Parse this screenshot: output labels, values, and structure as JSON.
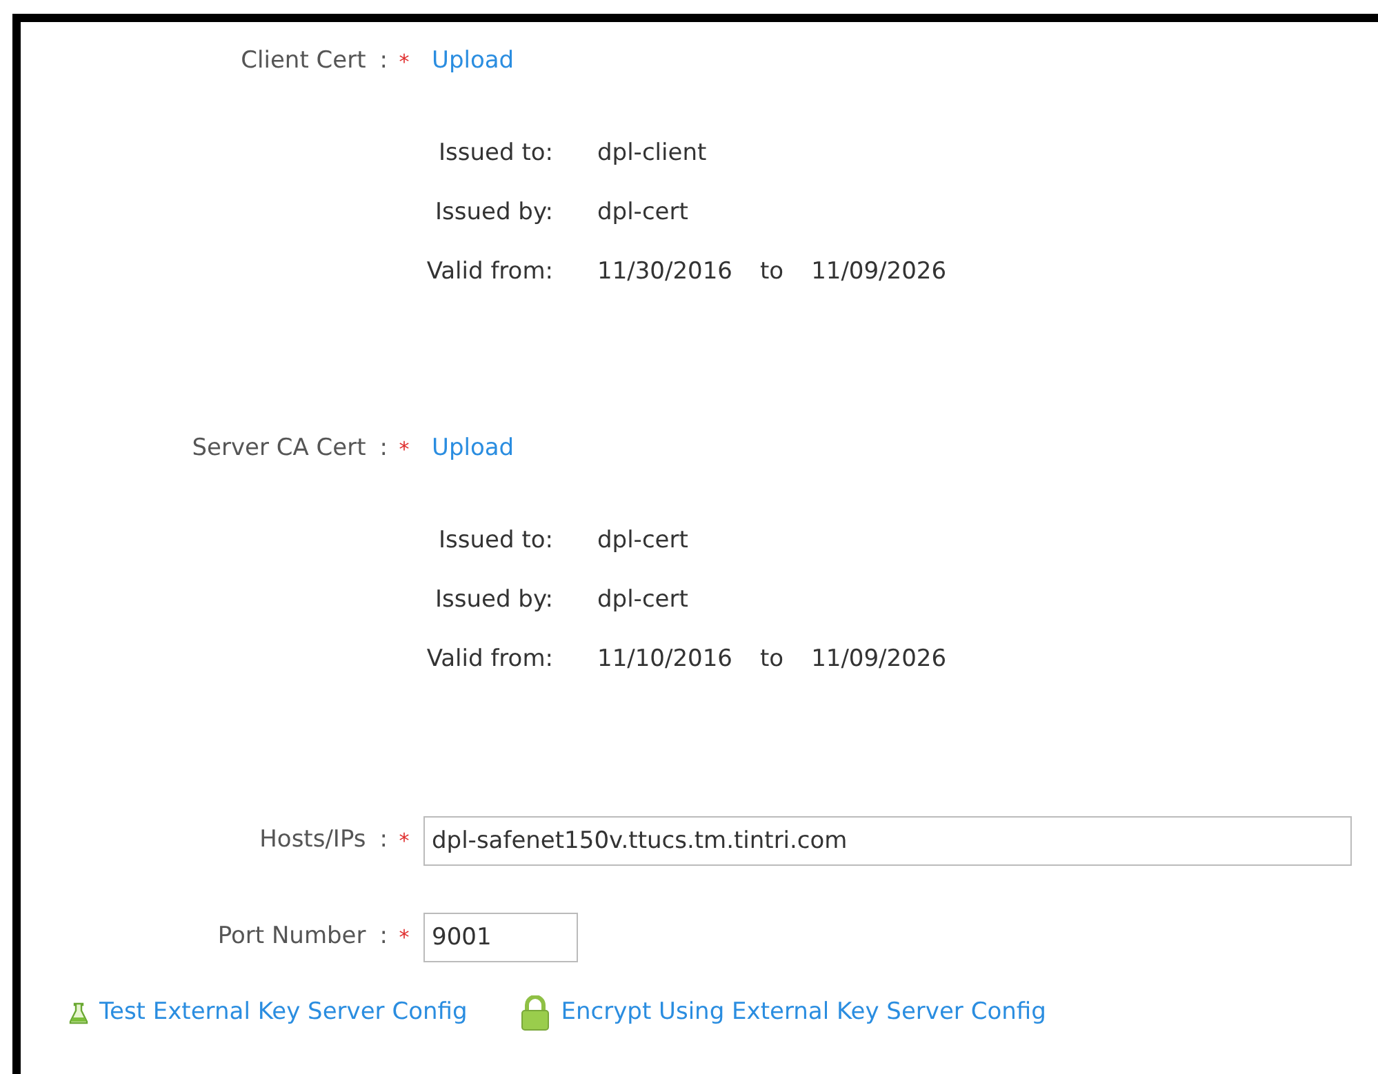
{
  "certificates": [
    {
      "label": "Client Cert",
      "separator": ":",
      "required_mark": "*",
      "action": "Upload",
      "details": [
        {
          "label": "Issued to:",
          "value": "dpl-client"
        },
        {
          "label": "Issued by:",
          "value": "dpl-cert"
        }
      ],
      "valid_label": "Valid from:",
      "valid_from": "11/30/2016",
      "valid_to_word": "to",
      "valid_to": "11/09/2026"
    },
    {
      "label": "Server CA Cert",
      "separator": ":",
      "required_mark": "*",
      "action": "Upload",
      "details": [
        {
          "label": "Issued to:",
          "value": "dpl-cert"
        },
        {
          "label": "Issued by:",
          "value": "dpl-cert"
        }
      ],
      "valid_label": "Valid from:",
      "valid_from": "11/10/2016",
      "valid_to_word": "to",
      "valid_to": "11/09/2026"
    }
  ],
  "fields": [
    {
      "label": "Hosts/IPs",
      "separator": ":",
      "required_mark": "*",
      "value": "dpl-safenet150v.ttucs.tm.tintri.com",
      "kind": "wide"
    },
    {
      "label": "Port Number",
      "separator": ":",
      "required_mark": "*",
      "value": "9001",
      "kind": "short"
    }
  ],
  "links": [
    {
      "label": "Test External Key Server Config",
      "kind": "test"
    },
    {
      "label": "Encrypt Using External Key Server Config",
      "kind": "encrypt"
    }
  ]
}
